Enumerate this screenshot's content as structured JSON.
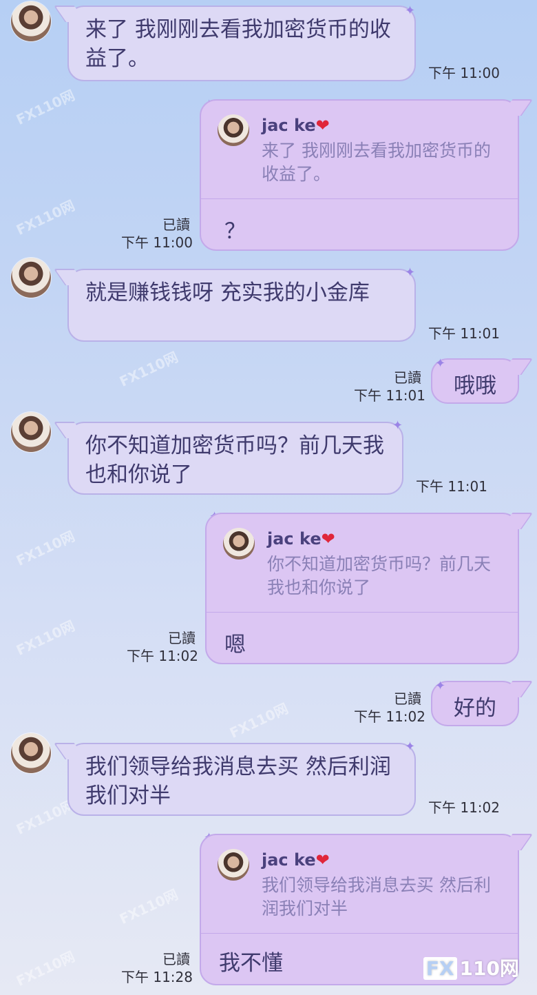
{
  "watermark": "FX110网",
  "logo": {
    "fx": "FX",
    "rest": "110网"
  },
  "messages": [
    {
      "text": "来了  我刚刚去看我加密货币的收益了。",
      "time": "下午 11:00"
    },
    {
      "reply": {
        "name": "jac ke",
        "quote": "来了  我刚刚去看我加密货币的收益了。",
        "text": "？"
      },
      "read": "已讀",
      "time": "下午 11:00"
    },
    {
      "text": "就是赚钱钱呀  充实我的小金库",
      "time": "下午 11:01"
    },
    {
      "text": "哦哦",
      "read": "已讀",
      "time": "下午 11:01"
    },
    {
      "text": "你不知道加密货币吗？前几天我也和你说了",
      "time": "下午 11:01"
    },
    {
      "reply": {
        "name": "jac ke",
        "quote": "你不知道加密货币吗？前几天我也和你说了",
        "text": "嗯"
      },
      "read": "已讀",
      "time": "下午 11:02"
    },
    {
      "text": "好的",
      "read": "已讀",
      "time": "下午 11:02"
    },
    {
      "text": "我们领导给我消息去买  然后利润我们对半",
      "time": "下午 11:02"
    },
    {
      "reply": {
        "name": "jac ke",
        "quote": "我们领导给我消息去买 然后利润我们对半",
        "text": "我不懂"
      },
      "read": "已讀",
      "time": "下午 11:28"
    }
  ]
}
